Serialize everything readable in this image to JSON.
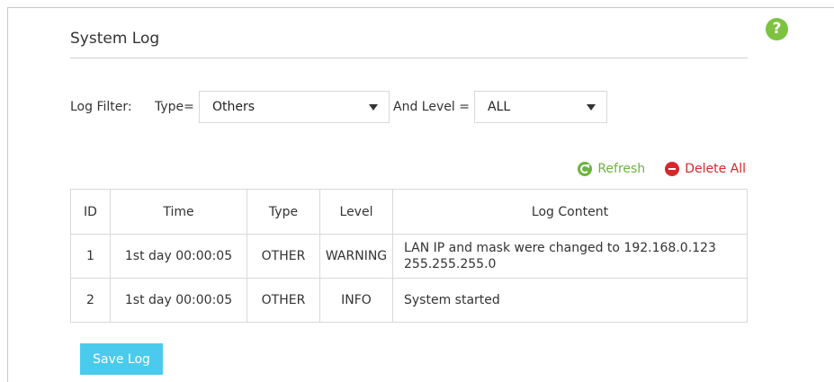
{
  "page": {
    "title": "System Log",
    "help_icon": "?"
  },
  "filter": {
    "label": "Log Filter:",
    "type_label": "Type=",
    "type_value": "Others",
    "level_label": "And Level =",
    "level_value": "ALL"
  },
  "actions": {
    "refresh": "Refresh",
    "delete_all": "Delete All"
  },
  "colors": {
    "refresh": "#6cb33f",
    "delete": "#d9262c",
    "save_button": "#4acbee",
    "help": "#7dc241"
  },
  "table": {
    "headers": [
      "ID",
      "Time",
      "Type",
      "Level",
      "Log Content"
    ],
    "rows": [
      {
        "id": "1",
        "time": "1st day 00:00:05",
        "type": "OTHER",
        "level": "WARNING",
        "content_line1": "LAN IP and mask were changed to 192.168.0.123",
        "content_line2": "255.255.255.0"
      },
      {
        "id": "2",
        "time": "1st day 00:00:05",
        "type": "OTHER",
        "level": "INFO",
        "content_line1": "System started",
        "content_line2": ""
      }
    ]
  },
  "save_button": "Save Log"
}
